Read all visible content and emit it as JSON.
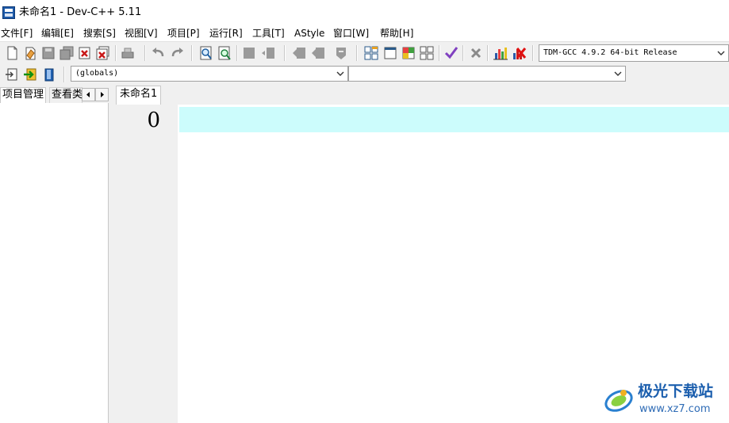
{
  "window": {
    "title": "未命名1 - Dev-C++ 5.11",
    "icon": "dev-cpp-app-icon"
  },
  "menubar": {
    "items": [
      "文件[F]",
      "编辑[E]",
      "搜索[S]",
      "视图[V]",
      "项目[P]",
      "运行[R]",
      "工具[T]",
      "AStyle",
      "窗口[W]",
      "帮助[H]"
    ]
  },
  "toolbar": {
    "compiler_select": "TDM-GCC 4.9.2 64-bit Release",
    "scope_select": "(globals)",
    "member_select": ""
  },
  "left_panel": {
    "tabs": [
      "项目管理",
      "查看类"
    ]
  },
  "editor": {
    "tab_label": "未命名1",
    "line_number": "0",
    "current_line_color": "#ccfcfc"
  },
  "watermark": {
    "title": "极光下载站",
    "url": "www.xz7.com"
  }
}
